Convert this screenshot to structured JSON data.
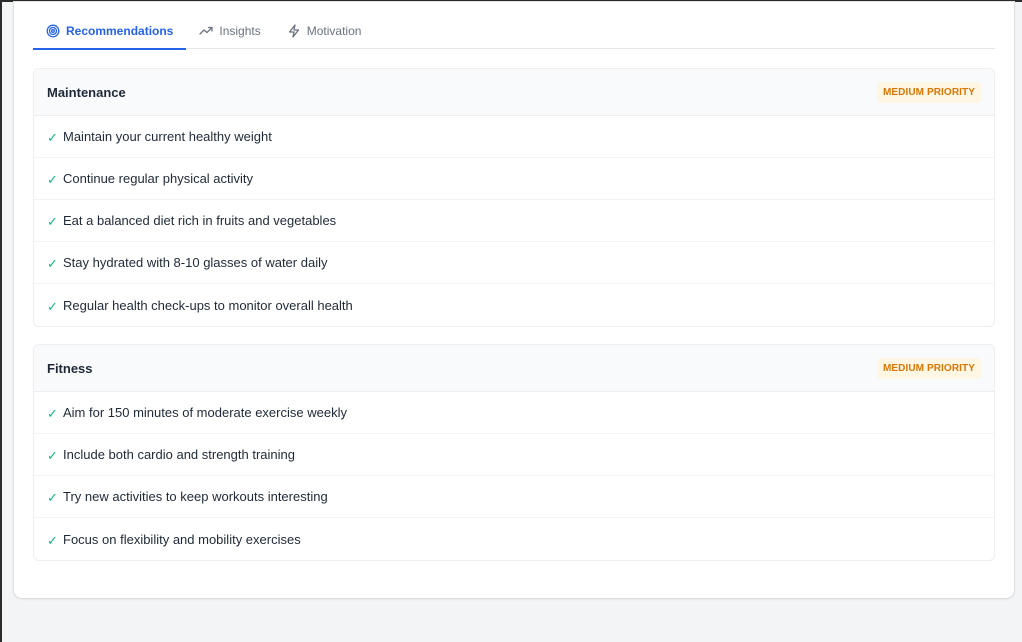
{
  "tabs": [
    {
      "label": "Recommendations",
      "icon": "target-icon",
      "active": true
    },
    {
      "label": "Insights",
      "icon": "trending-up-icon",
      "active": false
    },
    {
      "label": "Motivation",
      "icon": "lightning-icon",
      "active": false
    }
  ],
  "sections": [
    {
      "title": "Maintenance",
      "priority": "MEDIUM PRIORITY",
      "items": [
        "Maintain your current healthy weight",
        "Continue regular physical activity",
        "Eat a balanced diet rich in fruits and vegetables",
        "Stay hydrated with 8-10 glasses of water daily",
        "Regular health check-ups to monitor overall health"
      ]
    },
    {
      "title": "Fitness",
      "priority": "MEDIUM PRIORITY",
      "items": [
        "Aim for 150 minutes of moderate exercise weekly",
        "Include both cardio and strength training",
        "Try new activities to keep workouts interesting",
        "Focus on flexibility and mobility exercises"
      ]
    }
  ],
  "check_glyph": "✓",
  "colors": {
    "accent": "#2563eb",
    "check": "#10b981",
    "priority": "#d97706"
  }
}
